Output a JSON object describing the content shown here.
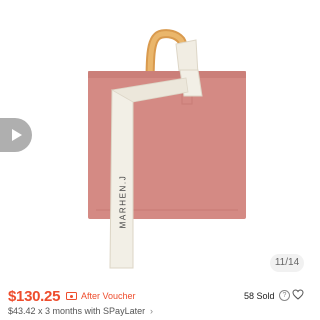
{
  "product": {
    "image_counter": "11/14",
    "strap_text": "MARHEN.J",
    "bag_color": "#d4857e",
    "handle_color": "#e0a458",
    "strap_color": "#f2efe6"
  },
  "price_bar": {
    "price": "$130.25",
    "voucher_label": "After Voucher",
    "sold": "58 Sold",
    "installment": "$43.42 x 3 months with SPayLater",
    "help_glyph": "?",
    "chevron": "›",
    "accent_color": "#ee4d2d"
  }
}
